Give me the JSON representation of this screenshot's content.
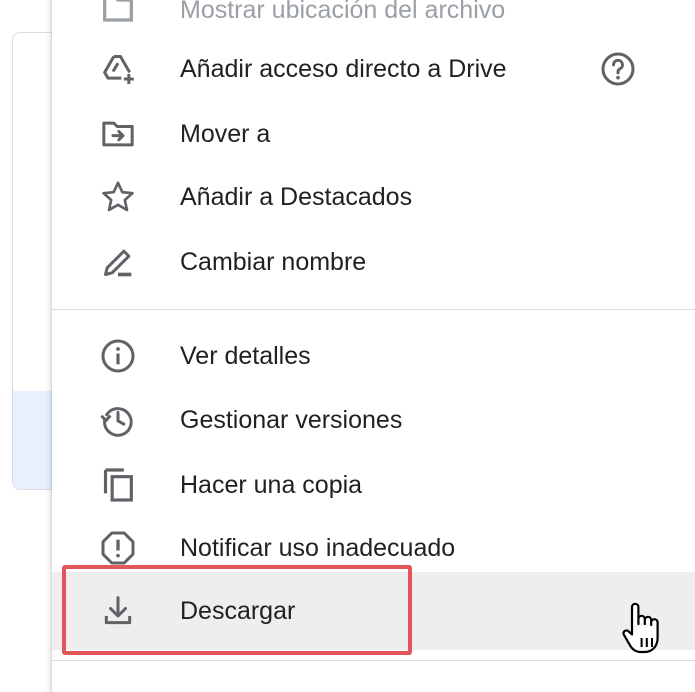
{
  "background": {
    "panel_highlight_color": "#e8f0fe"
  },
  "menu": {
    "items": [
      {
        "label": "Mostrar ubicación del archivo",
        "icon": "folder-location-icon",
        "faded": true
      },
      {
        "label": "Añadir acceso directo a Drive",
        "icon": "add-shortcut-icon",
        "help_icon": "help-circle-icon"
      },
      {
        "label": "Mover a",
        "icon": "move-to-folder-icon"
      },
      {
        "label": "Añadir a Destacados",
        "icon": "star-outline-icon"
      },
      {
        "label": "Cambiar nombre",
        "icon": "pencil-rename-icon"
      },
      {
        "label": "Ver detalles",
        "icon": "info-circle-icon"
      },
      {
        "label": "Gestionar versiones",
        "icon": "history-icon"
      },
      {
        "label": "Hacer una copia",
        "icon": "copy-icon"
      },
      {
        "label": "Notificar uso inadecuado",
        "icon": "report-abuse-icon"
      },
      {
        "label": "Descargar",
        "icon": "download-icon",
        "hovered": true
      }
    ]
  },
  "annotation": {
    "highlight_target": "Descargar",
    "highlight_color": "#e25558"
  },
  "cursor": {
    "type": "hand-pointer-icon"
  }
}
